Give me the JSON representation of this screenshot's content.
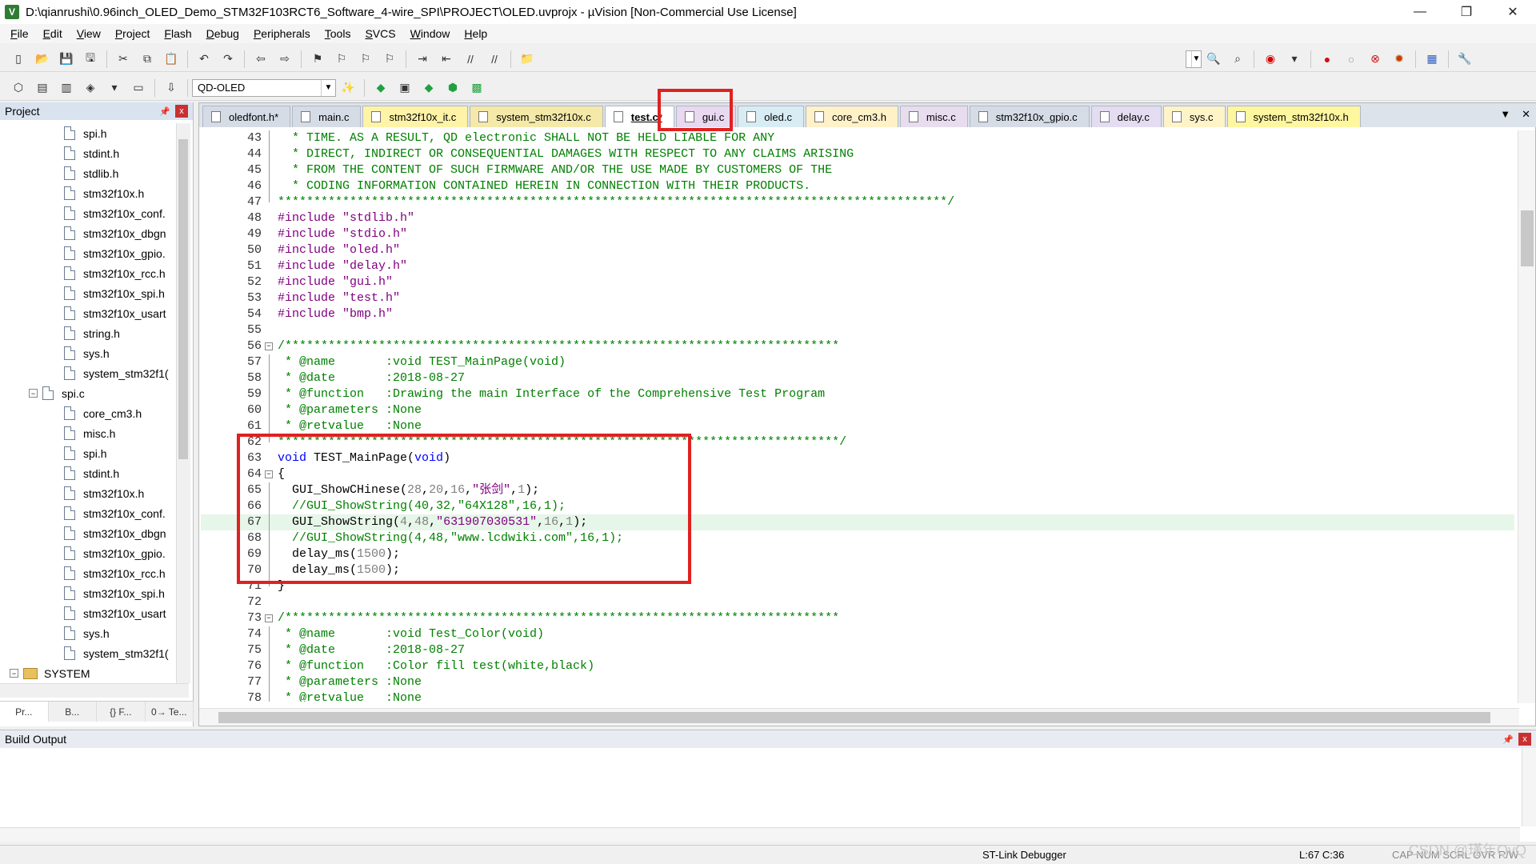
{
  "window": {
    "title": "D:\\qianrushi\\0.96inch_OLED_Demo_STM32F103RCT6_Software_4-wire_SPI\\PROJECT\\OLED.uvprojx - µVision  [Non-Commercial Use License]",
    "icon_label": "V",
    "minimize": "—",
    "restore": "❐",
    "close": "✕"
  },
  "menu": [
    "File",
    "Edit",
    "View",
    "Project",
    "Flash",
    "Debug",
    "Peripherals",
    "Tools",
    "SVCS",
    "Window",
    "Help"
  ],
  "toolbar2": {
    "target": "QD-OLED"
  },
  "project_panel": {
    "title": "Project",
    "pin": "📌",
    "close": "x",
    "tree": [
      {
        "label": "spi.h",
        "indent": 1,
        "kind": "file"
      },
      {
        "label": "stdint.h",
        "indent": 1,
        "kind": "file"
      },
      {
        "label": "stdlib.h",
        "indent": 1,
        "kind": "file"
      },
      {
        "label": "stm32f10x.h",
        "indent": 1,
        "kind": "file"
      },
      {
        "label": "stm32f10x_conf.",
        "indent": 1,
        "kind": "file"
      },
      {
        "label": "stm32f10x_dbgn",
        "indent": 1,
        "kind": "file"
      },
      {
        "label": "stm32f10x_gpio.",
        "indent": 1,
        "kind": "file"
      },
      {
        "label": "stm32f10x_rcc.h",
        "indent": 1,
        "kind": "file"
      },
      {
        "label": "stm32f10x_spi.h",
        "indent": 1,
        "kind": "file"
      },
      {
        "label": "stm32f10x_usart",
        "indent": 1,
        "kind": "file"
      },
      {
        "label": "string.h",
        "indent": 1,
        "kind": "file"
      },
      {
        "label": "sys.h",
        "indent": 1,
        "kind": "file"
      },
      {
        "label": "system_stm32f1(",
        "indent": 1,
        "kind": "file"
      },
      {
        "label": "spi.c",
        "indent": 0,
        "kind": "group"
      },
      {
        "label": "core_cm3.h",
        "indent": 1,
        "kind": "file"
      },
      {
        "label": "misc.h",
        "indent": 1,
        "kind": "file"
      },
      {
        "label": "spi.h",
        "indent": 1,
        "kind": "file"
      },
      {
        "label": "stdint.h",
        "indent": 1,
        "kind": "file"
      },
      {
        "label": "stm32f10x.h",
        "indent": 1,
        "kind": "file"
      },
      {
        "label": "stm32f10x_conf.",
        "indent": 1,
        "kind": "file"
      },
      {
        "label": "stm32f10x_dbgn",
        "indent": 1,
        "kind": "file"
      },
      {
        "label": "stm32f10x_gpio.",
        "indent": 1,
        "kind": "file"
      },
      {
        "label": "stm32f10x_rcc.h",
        "indent": 1,
        "kind": "file"
      },
      {
        "label": "stm32f10x_spi.h",
        "indent": 1,
        "kind": "file"
      },
      {
        "label": "stm32f10x_usart",
        "indent": 1,
        "kind": "file"
      },
      {
        "label": "sys.h",
        "indent": 1,
        "kind": "file"
      },
      {
        "label": "system_stm32f1(",
        "indent": 1,
        "kind": "file"
      },
      {
        "label": "SYSTEM",
        "indent": -1,
        "kind": "folder"
      }
    ],
    "tabs": [
      "Pr...",
      "B...",
      "{} F...",
      "0→ Te..."
    ]
  },
  "editor": {
    "tabs": [
      {
        "label": "oledfont.h*",
        "active": false,
        "color": "#d6dce6"
      },
      {
        "label": "main.c",
        "active": false,
        "color": "#d6dce6"
      },
      {
        "label": "stm32f10x_it.c",
        "active": false,
        "color": "#fff3a8"
      },
      {
        "label": "system_stm32f10x.c",
        "active": false,
        "color": "#f4e9a8"
      },
      {
        "label": "test.c*",
        "active": true,
        "color": "#ffffff"
      },
      {
        "label": "gui.c",
        "active": false,
        "color": "#e8d8f0"
      },
      {
        "label": "oled.c",
        "active": false,
        "color": "#d8ecf4"
      },
      {
        "label": "core_cm3.h",
        "active": false,
        "color": "#fff1c8"
      },
      {
        "label": "misc.c",
        "active": false,
        "color": "#e8dcef"
      },
      {
        "label": "stm32f10x_gpio.c",
        "active": false,
        "color": "#d6dce6"
      },
      {
        "label": "delay.c",
        "active": false,
        "color": "#e4dcf0"
      },
      {
        "label": "sys.c",
        "active": false,
        "color": "#fff3c8"
      },
      {
        "label": "system_stm32f10x.h",
        "active": false,
        "color": "#fff6a0"
      }
    ],
    "tab_menu": "▼",
    "tab_close": "✕",
    "lines": [
      {
        "n": "43",
        "fold": "line",
        "text": "  * TIME. AS A RESULT, QD electronic SHALL NOT BE HELD LIABLE FOR ANY",
        "cls": "c-com"
      },
      {
        "n": "44",
        "fold": "line",
        "text": "  * DIRECT, INDIRECT OR CONSEQUENTIAL DAMAGES WITH RESPECT TO ANY CLAIMS ARISING",
        "cls": "c-com"
      },
      {
        "n": "45",
        "fold": "line",
        "text": "  * FROM THE CONTENT OF SUCH FIRMWARE AND/OR THE USE MADE BY CUSTOMERS OF THE",
        "cls": "c-com"
      },
      {
        "n": "46",
        "fold": "line",
        "text": "  * CODING INFORMATION CONTAINED HEREIN IN CONNECTION WITH THEIR PRODUCTS.",
        "cls": "c-com"
      },
      {
        "n": "47",
        "fold": "end",
        "text": "*********************************************************************************************/",
        "cls": "c-com"
      },
      {
        "n": "48",
        "fold": "",
        "text": "#include \"stdlib.h\"",
        "cls": "c-pp"
      },
      {
        "n": "49",
        "fold": "",
        "text": "#include \"stdio.h\"",
        "cls": "c-pp"
      },
      {
        "n": "50",
        "fold": "",
        "text": "#include \"oled.h\"",
        "cls": "c-pp"
      },
      {
        "n": "51",
        "fold": "",
        "text": "#include \"delay.h\"",
        "cls": "c-pp"
      },
      {
        "n": "52",
        "fold": "",
        "text": "#include \"gui.h\"",
        "cls": "c-pp"
      },
      {
        "n": "53",
        "fold": "",
        "text": "#include \"test.h\"",
        "cls": "c-pp"
      },
      {
        "n": "54",
        "fold": "",
        "text": "#include \"bmp.h\"",
        "cls": "c-pp"
      },
      {
        "n": "55",
        "fold": "",
        "text": "",
        "cls": ""
      },
      {
        "n": "56",
        "fold": "box",
        "text": "/*****************************************************************************",
        "cls": "c-com"
      },
      {
        "n": "57",
        "fold": "line",
        "text": " * @name       :void TEST_MainPage(void)",
        "cls": "c-com"
      },
      {
        "n": "58",
        "fold": "line",
        "text": " * @date       :2018-08-27",
        "cls": "c-com"
      },
      {
        "n": "59",
        "fold": "line",
        "text": " * @function   :Drawing the main Interface of the Comprehensive Test Program",
        "cls": "c-com"
      },
      {
        "n": "60",
        "fold": "line",
        "text": " * @parameters :None",
        "cls": "c-com"
      },
      {
        "n": "61",
        "fold": "line",
        "text": " * @retvalue   :None",
        "cls": "c-com"
      },
      {
        "n": "62",
        "fold": "end",
        "text": "******************************************************************************/",
        "cls": "c-com"
      },
      {
        "n": "63",
        "fold": "",
        "text": "void TEST_MainPage(void)",
        "cls": "code-fn"
      },
      {
        "n": "64",
        "fold": "box",
        "text": "{",
        "cls": ""
      },
      {
        "n": "65",
        "fold": "line",
        "text": "  GUI_ShowCHinese(28,20,16,\"张剑\",1);",
        "cls": "code-call",
        "warn": true
      },
      {
        "n": "66",
        "fold": "line",
        "text": "  //GUI_ShowString(40,32,\"64X128\",16,1);",
        "cls": "c-com"
      },
      {
        "n": "67",
        "fold": "line",
        "text": "  GUI_ShowString(4,48,\"631907030531\",16,1);",
        "cls": "code-call",
        "warn": true,
        "hl": true
      },
      {
        "n": "68",
        "fold": "line",
        "text": "  //GUI_ShowString(4,48,\"www.lcdwiki.com\",16,1);",
        "cls": "c-com"
      },
      {
        "n": "69",
        "fold": "line",
        "text": "  delay_ms(1500);",
        "cls": "code-call"
      },
      {
        "n": "70",
        "fold": "line",
        "text": "  delay_ms(1500);",
        "cls": "code-call"
      },
      {
        "n": "71",
        "fold": "end",
        "text": "}",
        "cls": ""
      },
      {
        "n": "72",
        "fold": "",
        "text": "",
        "cls": ""
      },
      {
        "n": "73",
        "fold": "box",
        "text": "/*****************************************************************************",
        "cls": "c-com"
      },
      {
        "n": "74",
        "fold": "line",
        "text": " * @name       :void Test_Color(void)",
        "cls": "c-com"
      },
      {
        "n": "75",
        "fold": "line",
        "text": " * @date       :2018-08-27",
        "cls": "c-com"
      },
      {
        "n": "76",
        "fold": "line",
        "text": " * @function   :Color fill test(white,black)",
        "cls": "c-com"
      },
      {
        "n": "77",
        "fold": "line",
        "text": " * @parameters :None",
        "cls": "c-com"
      },
      {
        "n": "78",
        "fold": "line",
        "text": " * @retvalue   :None",
        "cls": "c-com"
      }
    ]
  },
  "build_output": {
    "title": "Build Output"
  },
  "status": {
    "debugger": "ST-Link Debugger",
    "position": "L:67 C:36",
    "flags": "CAP  NUM  SCRL  OVR  R/W"
  },
  "watermark": "CSDN @瑾年QvQ",
  "colors": {
    "highlight_box": "#e02020",
    "active_line": "#e6f6e8",
    "comment": "#008000",
    "string": "#800080",
    "keyword": "#0000ff"
  }
}
